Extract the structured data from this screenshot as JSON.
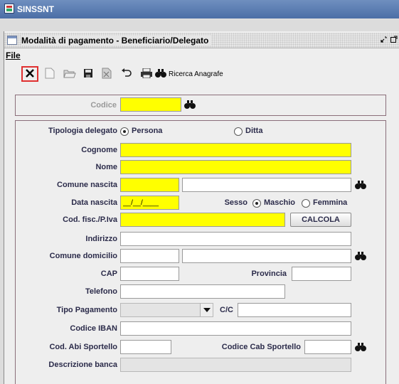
{
  "app": {
    "title": "SINSSNT"
  },
  "frame": {
    "title": "Modalità di pagamento - Beneficiario/Delegato"
  },
  "menu": {
    "file": "File"
  },
  "toolbar": {
    "search_label": "Ricerca Anagrafe"
  },
  "codice": {
    "label": "Codice",
    "value": ""
  },
  "form": {
    "tipologia_label": "Tipologia delegato",
    "tipologia_options": [
      "Persona",
      "Ditta"
    ],
    "tipologia_selected": "Persona",
    "cognome_label": "Cognome",
    "nome_label": "Nome",
    "comune_nascita_label": "Comune nascita",
    "data_nascita_label": "Data nascita",
    "data_nascita_value": "__/__/____",
    "sesso_label": "Sesso",
    "sesso_options": [
      "Maschio",
      "Femmina"
    ],
    "sesso_selected": "Maschio",
    "codfisc_label": "Cod. fisc./P.Iva",
    "calcola_label": "CALCOLA",
    "indirizzo_label": "Indirizzo",
    "comune_domicilio_label": "Comune domicilio",
    "cap_label": "CAP",
    "provincia_label": "Provincia",
    "telefono_label": "Telefono",
    "tipo_pagamento_label": "Tipo Pagamento",
    "cc_label": "C/C",
    "iban_label": "Codice IBAN",
    "abi_label": "Cod. Abi Sportello",
    "cab_label": "Codice Cab Sportello",
    "descrizione_banca_label": "Descrizione banca"
  },
  "colors": {
    "required_field": "#ffff00",
    "title_bar": "#4b6ea6",
    "panel_border": "#8a6e7a",
    "close_highlight": "#e03030"
  }
}
